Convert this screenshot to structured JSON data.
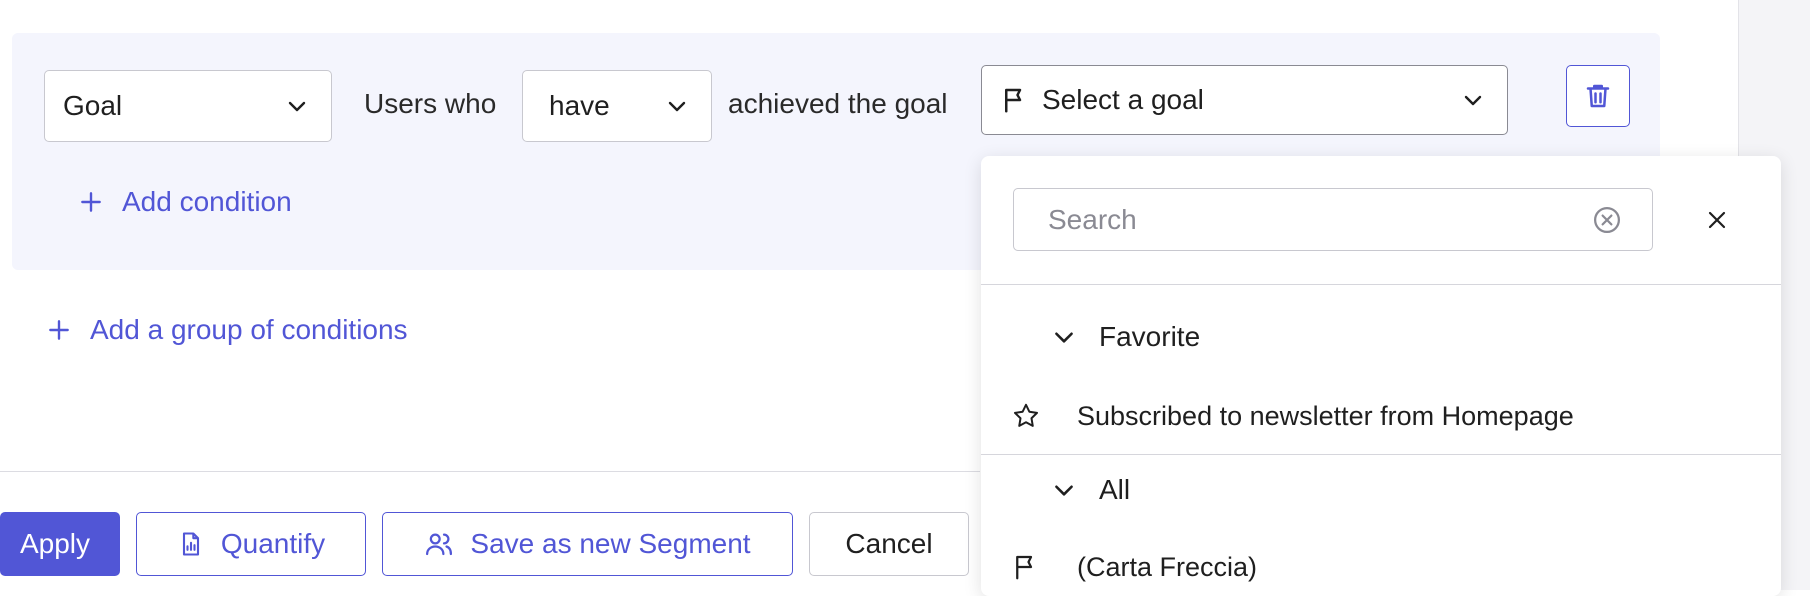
{
  "condition": {
    "type_select": {
      "value": "Goal"
    },
    "users_who_label": "Users who",
    "have_select": {
      "value": "have"
    },
    "achieved_label": "achieved the goal",
    "goal_select": {
      "placeholder": "Select a goal"
    }
  },
  "add_condition_label": "Add condition",
  "add_group_label": "Add a group of conditions",
  "footer": {
    "apply_label": "Apply",
    "quantify_label": "Quantify",
    "save_segment_label": "Save as new Segment",
    "cancel_label": "Cancel"
  },
  "dropdown": {
    "search": {
      "placeholder": "Search",
      "value": ""
    },
    "groups": [
      {
        "label": "Favorite",
        "items": [
          {
            "label": "Subscribed to newsletter from Homepage",
            "icon": "star-icon"
          }
        ]
      },
      {
        "label": "All",
        "items": [
          {
            "label": "(Carta Freccia)",
            "icon": "flag-icon"
          }
        ]
      }
    ]
  },
  "colors": {
    "accent": "#5156d6",
    "group_bg": "#f4f5fd"
  }
}
